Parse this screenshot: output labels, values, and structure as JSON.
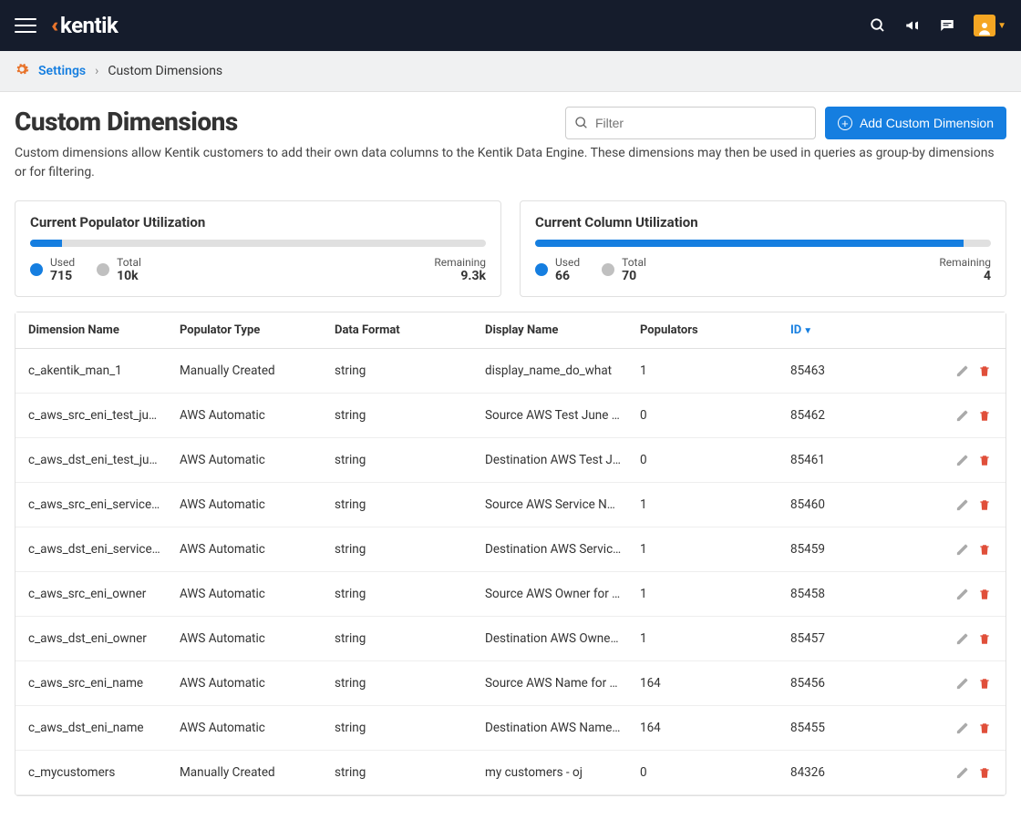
{
  "brand": "kentik",
  "breadcrumb": {
    "root": "Settings",
    "current": "Custom Dimensions"
  },
  "page": {
    "title": "Custom Dimensions",
    "description": "Custom dimensions allow Kentik customers to add their own data columns to the Kentik Data Engine. These dimensions may then be used in queries as group-by dimensions or for filtering."
  },
  "filter": {
    "placeholder": "Filter"
  },
  "add_button": "Add Custom Dimension",
  "util": {
    "populator": {
      "title": "Current Populator Utilization",
      "used_label": "Used",
      "used": "715",
      "total_label": "Total",
      "total": "10k",
      "remaining_label": "Remaining",
      "remaining": "9.3k",
      "percent": 7
    },
    "column": {
      "title": "Current Column Utilization",
      "used_label": "Used",
      "used": "66",
      "total_label": "Total",
      "total": "70",
      "remaining_label": "Remaining",
      "remaining": "4",
      "percent": 94
    }
  },
  "columns": {
    "name": "Dimension Name",
    "poptype": "Populator Type",
    "format": "Data Format",
    "display": "Display Name",
    "populators": "Populators",
    "id": "ID"
  },
  "rows": [
    {
      "name": "c_akentik_man_1",
      "poptype": "Manually Created",
      "format": "string",
      "display": "display_name_do_what",
      "populators": "1",
      "id": "85463"
    },
    {
      "name": "c_aws_src_eni_test_june",
      "poptype": "AWS Automatic",
      "format": "string",
      "display": "Source AWS Test June fo...",
      "populators": "0",
      "id": "85462"
    },
    {
      "name": "c_aws_dst_eni_test_june",
      "poptype": "AWS Automatic",
      "format": "string",
      "display": "Destination AWS Test Jun...",
      "populators": "0",
      "id": "85461"
    },
    {
      "name": "c_aws_src_eni_service_n...",
      "poptype": "AWS Automatic",
      "format": "string",
      "display": "Source AWS Service Nam...",
      "populators": "1",
      "id": "85460"
    },
    {
      "name": "c_aws_dst_eni_service_n...",
      "poptype": "AWS Automatic",
      "format": "string",
      "display": "Destination AWS Service ...",
      "populators": "1",
      "id": "85459"
    },
    {
      "name": "c_aws_src_eni_owner",
      "poptype": "AWS Automatic",
      "format": "string",
      "display": "Source AWS Owner for N...",
      "populators": "1",
      "id": "85458"
    },
    {
      "name": "c_aws_dst_eni_owner",
      "poptype": "AWS Automatic",
      "format": "string",
      "display": "Destination AWS Owner f...",
      "populators": "1",
      "id": "85457"
    },
    {
      "name": "c_aws_src_eni_name",
      "poptype": "AWS Automatic",
      "format": "string",
      "display": "Source AWS Name for Ne...",
      "populators": "164",
      "id": "85456"
    },
    {
      "name": "c_aws_dst_eni_name",
      "poptype": "AWS Automatic",
      "format": "string",
      "display": "Destination AWS Name f...",
      "populators": "164",
      "id": "85455"
    },
    {
      "name": "c_mycustomers",
      "poptype": "Manually Created",
      "format": "string",
      "display": "my customers - oj",
      "populators": "0",
      "id": "84326"
    }
  ]
}
